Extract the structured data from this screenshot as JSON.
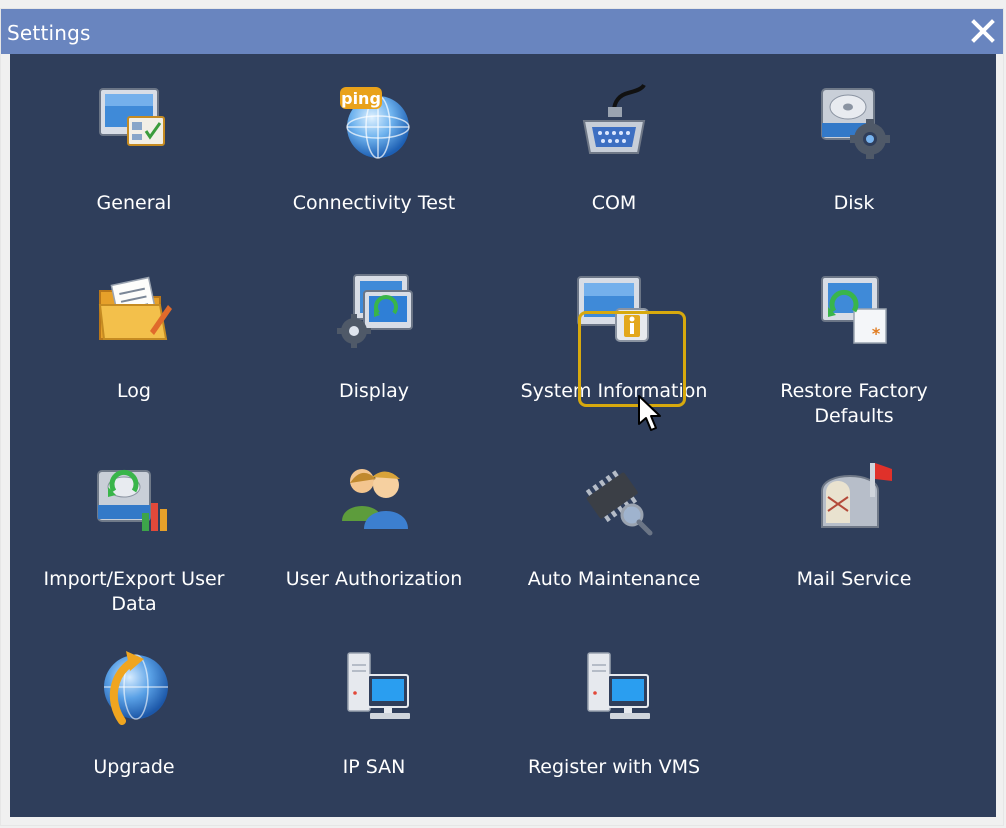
{
  "window": {
    "title": "Settings"
  },
  "colors": {
    "titlebar": "#6985bf",
    "panel": "#2f3e5b",
    "focus": "#d7a90e"
  },
  "items": [
    {
      "label": "General",
      "icon": "general-settings-icon"
    },
    {
      "label": "Connectivity Test",
      "icon": "ping-globe-icon"
    },
    {
      "label": "COM",
      "icon": "serial-port-icon"
    },
    {
      "label": "Disk",
      "icon": "disk-gear-icon"
    },
    {
      "label": "Log",
      "icon": "log-folder-icon"
    },
    {
      "label": "Display",
      "icon": "display-settings-icon"
    },
    {
      "label": "System Information",
      "icon": "system-info-icon",
      "selected": true
    },
    {
      "label": "Restore Factory\nDefaults",
      "icon": "restore-defaults-icon"
    },
    {
      "label": "Import/Export User\nData",
      "icon": "import-export-icon"
    },
    {
      "label": "User Authorization",
      "icon": "users-icon"
    },
    {
      "label": "Auto Maintenance",
      "icon": "chip-magnifier-icon"
    },
    {
      "label": "Mail Service",
      "icon": "mailbox-icon"
    },
    {
      "label": "Upgrade",
      "icon": "upgrade-globe-icon"
    },
    {
      "label": "IP SAN",
      "icon": "network-server-icon"
    },
    {
      "label": "Register with VMS",
      "icon": "network-server-icon"
    }
  ]
}
